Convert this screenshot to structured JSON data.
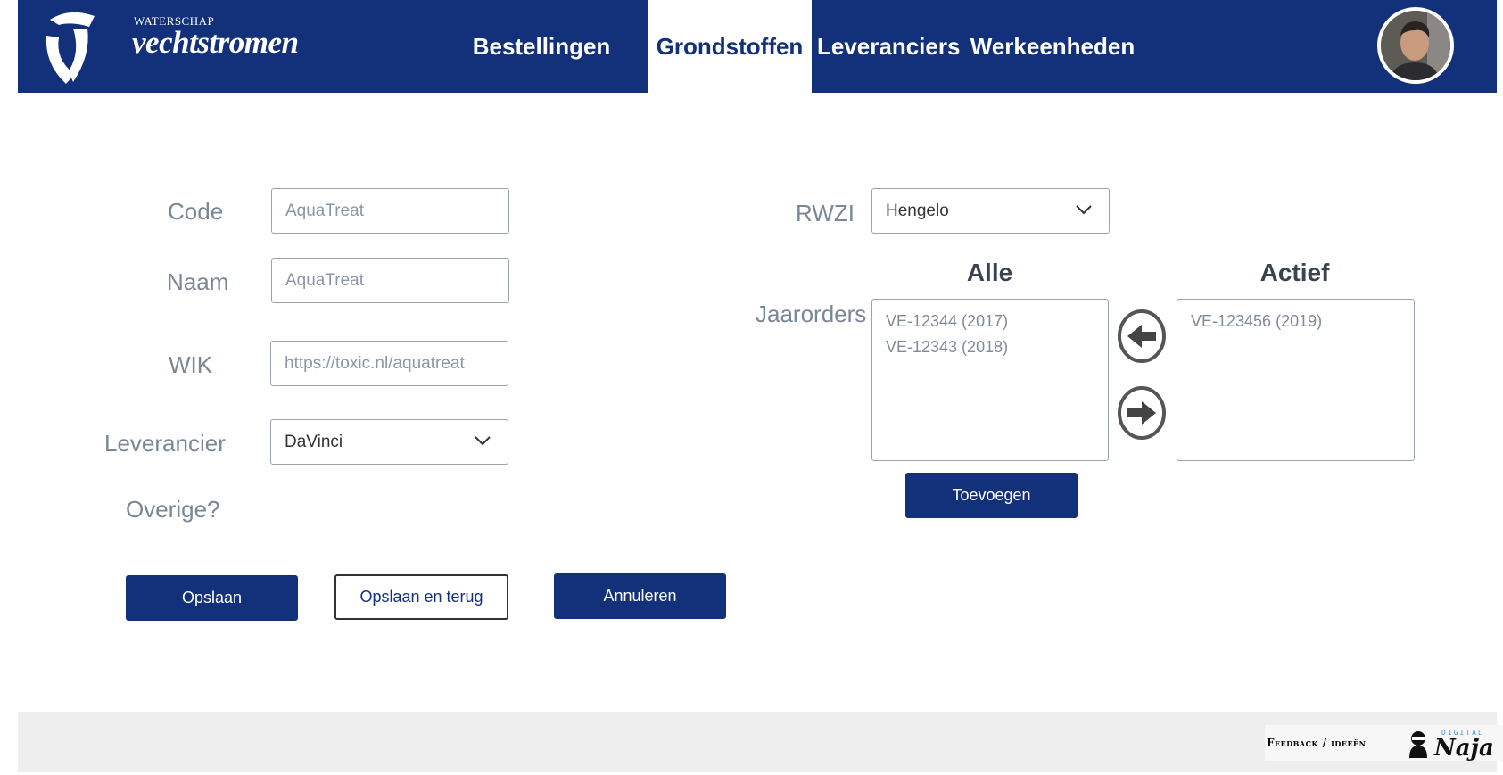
{
  "header": {
    "logo_small": "WATERSCHAP",
    "logo_big": "vechtstromen",
    "nav": [
      {
        "label": "Bestellingen",
        "active": false
      },
      {
        "label": "Grondstoffen",
        "active": true
      },
      {
        "label": "Leveranciers",
        "active": false
      },
      {
        "label": "Werkeenheden",
        "active": false
      }
    ]
  },
  "form": {
    "code_label": "Code",
    "code_placeholder": "AquaTreat",
    "naam_label": "Naam",
    "naam_placeholder": "AquaTreat",
    "wik_label": "WIK",
    "wik_placeholder": "https://toxic.nl/aquatreat",
    "leverancier_label": "Leverancier",
    "leverancier_value": "DaVinci",
    "overige_label": "Overige?",
    "rwzi_label": "RWZI",
    "rwzi_value": "Hengelo",
    "jaarorders_label": "Jaarorders"
  },
  "lists": {
    "alle_title": "Alle",
    "actief_title": "Actief",
    "alle_items": [
      "VE-12344 (2017)",
      "VE-12343 (2018)"
    ],
    "actief_items": [
      "VE-123456 (2019)"
    ],
    "add_button": "Toevoegen"
  },
  "buttons": {
    "save": "Opslaan",
    "save_back": "Opslaan en terug",
    "cancel": "Annuleren"
  },
  "footer": {
    "feedback": "Feedback / ideeën",
    "brand_small": "DIGITAL",
    "brand_big": "Naja"
  },
  "colors": {
    "brand": "#13307a",
    "label": "#7a8796"
  }
}
